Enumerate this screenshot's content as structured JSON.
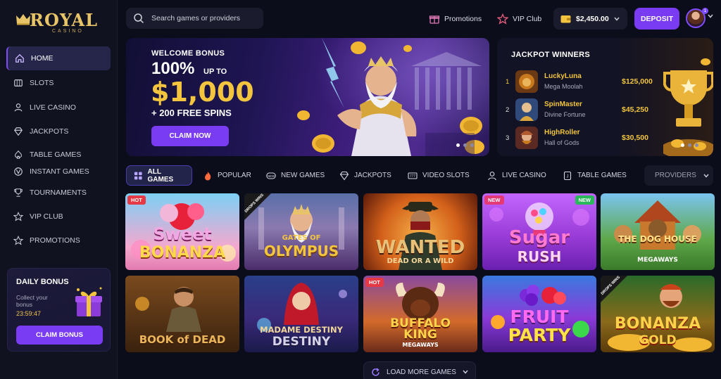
{
  "brand": {
    "name": "ROYAL",
    "sub": "CASINO"
  },
  "sidebar": {
    "items": [
      {
        "label": "HOME",
        "icon": "home-icon"
      },
      {
        "label": "SLOTS",
        "icon": "slots-icon"
      },
      {
        "label": "LIVE CASINO",
        "icon": "live-casino-icon"
      },
      {
        "label": "JACKPOTS",
        "icon": "diamond-icon"
      },
      {
        "label": "TABLE GAMES",
        "icon": "table-games-icon"
      },
      {
        "label": "INSTANT GAMES",
        "icon": "instant-games-icon"
      },
      {
        "label": "TOURNAMENTS",
        "icon": "trophy-icon"
      },
      {
        "label": "VIP CLUB",
        "icon": "star-icon"
      },
      {
        "label": "PROMOTIONS",
        "icon": "promotions-star-icon"
      }
    ],
    "daily_bonus": {
      "title": "DAILY BONUS",
      "subtitle": "Collect your bonus",
      "timer": "23:59:47",
      "button": "CLAIM BONUS"
    }
  },
  "header": {
    "search_placeholder": "Search games or providers",
    "promotions": "Promotions",
    "vip_club": "VIP Club",
    "balance": "$2,450.00",
    "deposit": "DEPOSIT",
    "notification_count": "1"
  },
  "hero": {
    "kicker": "WELCOME BONUS",
    "percent": "100%",
    "up_to": "UP TO",
    "amount": "$1,000",
    "spins": "+ 200 FREE SPINS",
    "button": "CLAIM NOW"
  },
  "jackpot": {
    "title": "JACKPOT WINNERS",
    "winners": [
      {
        "rank": "1",
        "name": "LuckyLuna",
        "game": "Mega Moolah",
        "amount": "$125,000"
      },
      {
        "rank": "2",
        "name": "SpinMaster",
        "game": "Divine Fortune",
        "amount": "$45,250"
      },
      {
        "rank": "3",
        "name": "HighRoller",
        "game": "Hall of Gods",
        "amount": "$30,500"
      }
    ]
  },
  "tabs": [
    {
      "label": "ALL GAMES",
      "icon": "grid-icon"
    },
    {
      "label": "POPULAR",
      "icon": "flame-icon"
    },
    {
      "label": "NEW GAMES",
      "icon": "new-icon"
    },
    {
      "label": "JACKPOTS",
      "icon": "diamond-icon"
    },
    {
      "label": "VIDEO SLOTS",
      "icon": "video-slots-icon"
    },
    {
      "label": "LIVE CASINO",
      "icon": "dealer-icon"
    },
    {
      "label": "TABLE GAMES",
      "icon": "cards-icon"
    }
  ],
  "providers_label": "PROVIDERS",
  "games": [
    {
      "title": "SWEET BONANZA",
      "line1": "Sweet",
      "line2": "BONANZA",
      "badge": "HOT"
    },
    {
      "title": "GATES OF OLYMPUS",
      "line1": "GATES OF",
      "line2": "OLYMPUS",
      "drops": "DROPS WINS"
    },
    {
      "title": "WANTED DEAD OR A WILD",
      "line1": "WANTED",
      "line2": "DEAD OR A WILD"
    },
    {
      "title": "SUGAR RUSH",
      "line1": "Sugar",
      "line2": "RUSH",
      "badge_left": "NEW",
      "badge_right": "NEW"
    },
    {
      "title": "THE DOG HOUSE MEGAWAYS",
      "line1": "THE DOG HOUSE",
      "line2": "MEGAWAYS"
    },
    {
      "title": "BOOK OF DEAD",
      "line1": "BOOK of DEAD"
    },
    {
      "title": "MADAME DESTINY",
      "line1": "MADAME DESTINY",
      "line2": "DESTINY"
    },
    {
      "title": "BUFFALO KING MEGAWAYS",
      "line1": "BUFFALO",
      "line2": "KING",
      "line3": "MEGAWAYS",
      "badge": "HOT"
    },
    {
      "title": "FRUIT PARTY",
      "line1": "FRUIT",
      "line2": "PARTY"
    },
    {
      "title": "BONANZA GOLD",
      "line1": "BONANZA",
      "line2": "GOLD",
      "drops": "DROPS WINS"
    }
  ],
  "load_more": "LOAD MORE GAMES",
  "colors": {
    "accent": "#7a3cf3",
    "gold": "#f3c53e",
    "background": "#0c0d1a"
  }
}
